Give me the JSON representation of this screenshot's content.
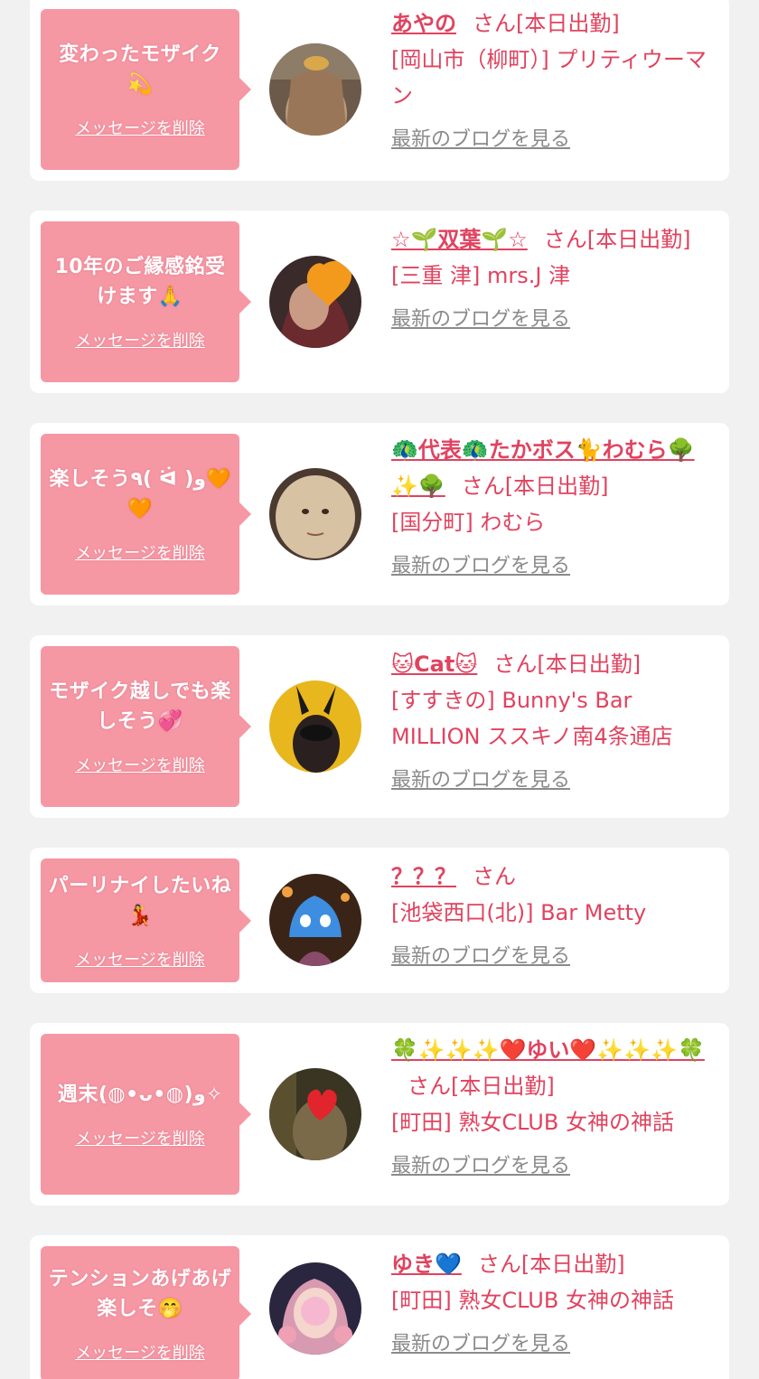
{
  "colors": {
    "background": "#f1f1f1",
    "card": "#ffffff",
    "bubble": "#f697a4",
    "accent_text": "#e0435f",
    "link_gray": "#8a8a8a"
  },
  "items": [
    {
      "message": "変わったモザイク💫",
      "delete_label": "メッセージを削除",
      "name": "あやの",
      "status": "さん[本日出勤]",
      "shop": "[岡山市（柳町）] プリティウーマン",
      "blog_label": "最新のブログを見る",
      "avatar_icon": "avatar-photo"
    },
    {
      "message": "10年のご縁感銘受けます🙏",
      "delete_label": "メッセージを削除",
      "name": "☆🌱双葉🌱☆",
      "status": "さん[本日出勤]",
      "shop": "[三重 津] mrs.J 津",
      "blog_label": "最新のブログを見る",
      "avatar_icon": "avatar-photo"
    },
    {
      "message": "楽しそう٩( ᐛ )و🧡🧡",
      "delete_label": "メッセージを削除",
      "name": "🦚代表🦚たかボス🐈わむら🌳✨🌳",
      "status": "さん[本日出勤]",
      "shop": "[国分町] わむら",
      "blog_label": "最新のブログを見る",
      "avatar_icon": "avatar-photo"
    },
    {
      "message": "モザイク越しでも楽しそう💞",
      "delete_label": "メッセージを削除",
      "name": "🐱Cat🐱",
      "status": "さん[本日出勤]",
      "shop": "[すすきの] Bunny's Bar MILLION ススキノ南4条通店",
      "blog_label": "最新のブログを見る",
      "avatar_icon": "avatar-photo"
    },
    {
      "message": "パーリナイしたいね💃",
      "delete_label": "メッセージを削除",
      "name": "？？？",
      "status": "さん",
      "shop": "[池袋西口(北)] Bar Metty",
      "blog_label": "最新のブログを見る",
      "avatar_icon": "avatar-photo"
    },
    {
      "message": "週末(◍•ᴗ•◍)و✧",
      "delete_label": "メッセージを削除",
      "name": "🍀✨✨✨❤️ゆい❤️✨✨✨🍀",
      "status": "さん[本日出勤]",
      "shop": "[町田] 熟女CLUB 女神の神話",
      "blog_label": "最新のブログを見る",
      "avatar_icon": "avatar-photo"
    },
    {
      "message": "テンションあげあげ楽しそ🤭",
      "delete_label": "メッセージを削除",
      "name": "ゆき💙",
      "status": "さん[本日出勤]",
      "shop": "[町田] 熟女CLUB 女神の神話",
      "blog_label": "最新のブログを見る",
      "avatar_icon": "avatar-photo"
    }
  ]
}
